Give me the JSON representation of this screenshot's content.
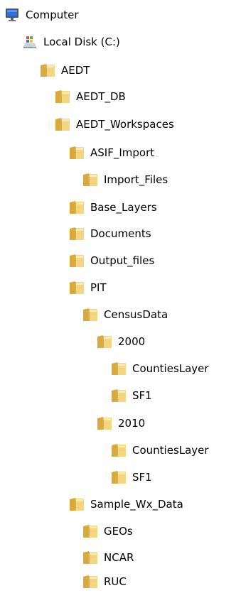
{
  "tree": {
    "nodes": [
      {
        "label": "Computer",
        "icon": "computer-icon",
        "depth": 0
      },
      {
        "label": "Local Disk (C:)",
        "icon": "local-disk-icon",
        "depth": 1
      },
      {
        "label": "AEDT",
        "icon": "folder-icon",
        "depth": 2
      },
      {
        "label": "AEDT_DB",
        "icon": "folder-icon",
        "depth": 3
      },
      {
        "label": "AEDT_Workspaces",
        "icon": "folder-icon",
        "depth": 3
      },
      {
        "label": "ASIF_Import",
        "icon": "folder-icon",
        "depth": 4
      },
      {
        "label": "Import_Files",
        "icon": "folder-icon",
        "depth": 5
      },
      {
        "label": "Base_Layers",
        "icon": "folder-icon",
        "depth": 4
      },
      {
        "label": "Documents",
        "icon": "folder-icon",
        "depth": 4
      },
      {
        "label": "Output_files",
        "icon": "folder-icon",
        "depth": 4
      },
      {
        "label": "PIT",
        "icon": "folder-icon",
        "depth": 4
      },
      {
        "label": "CensusData",
        "icon": "folder-icon",
        "depth": 5
      },
      {
        "label": "2000",
        "icon": "folder-icon",
        "depth": 6
      },
      {
        "label": "CountiesLayer",
        "icon": "folder-icon",
        "depth": 7
      },
      {
        "label": "SF1",
        "icon": "folder-icon",
        "depth": 7
      },
      {
        "label": "2010",
        "icon": "folder-icon",
        "depth": 6
      },
      {
        "label": "CountiesLayer",
        "icon": "folder-icon",
        "depth": 7
      },
      {
        "label": "SF1",
        "icon": "folder-icon",
        "depth": 7
      },
      {
        "label": "Sample_Wx_Data",
        "icon": "folder-icon",
        "depth": 4
      },
      {
        "label": "GEOs",
        "icon": "folder-icon",
        "depth": 5
      },
      {
        "label": "NCAR",
        "icon": "folder-icon",
        "depth": 5
      },
      {
        "label": "RUC",
        "icon": "folder-icon",
        "depth": 5
      }
    ]
  },
  "colors": {
    "folder_back": "#d9a93a",
    "folder_front": "#f6d67c",
    "folder_highlight": "#fbeab0",
    "folder_shadow": "#b9862a",
    "monitor_screen": "#2f6fd6",
    "disk_body": "#c9d3dc"
  }
}
